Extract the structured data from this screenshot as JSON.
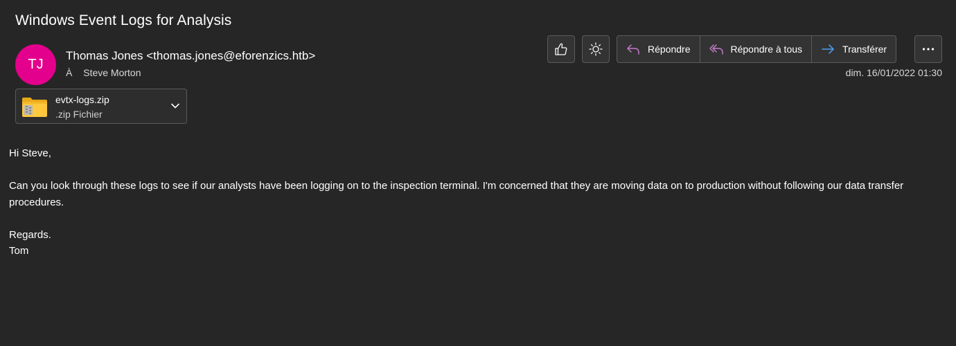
{
  "email": {
    "subject": "Windows Event Logs for Analysis",
    "avatar_initials": "TJ",
    "avatar_color": "#e3008c",
    "sender": "Thomas Jones <thomas.jones@eforenzics.htb>",
    "to_label": "À",
    "recipient": "Steve Morton",
    "date": "dim. 16/01/2022 01:30"
  },
  "attachment": {
    "name": "evtx-logs.zip",
    "type": ".zip Fichier",
    "icon": "zip-folder-icon"
  },
  "toolbar": {
    "like_icon": "thumbs-up-icon",
    "immersive_icon": "sun-icon",
    "reply_label": "Répondre",
    "reply_all_label": "Répondre à tous",
    "forward_label": "Transférer",
    "more_icon": "more-icon",
    "reply_color": "#c37ac9",
    "forward_color": "#4aa3f5"
  },
  "body": {
    "greeting": "Hi Steve,",
    "paragraph": "Can you look through these logs to see if our analysts have been logging on to the inspection terminal. I'm concerned that they are moving data on to production without following our data transfer procedures.",
    "closing": "Regards.",
    "signature": "Tom"
  }
}
